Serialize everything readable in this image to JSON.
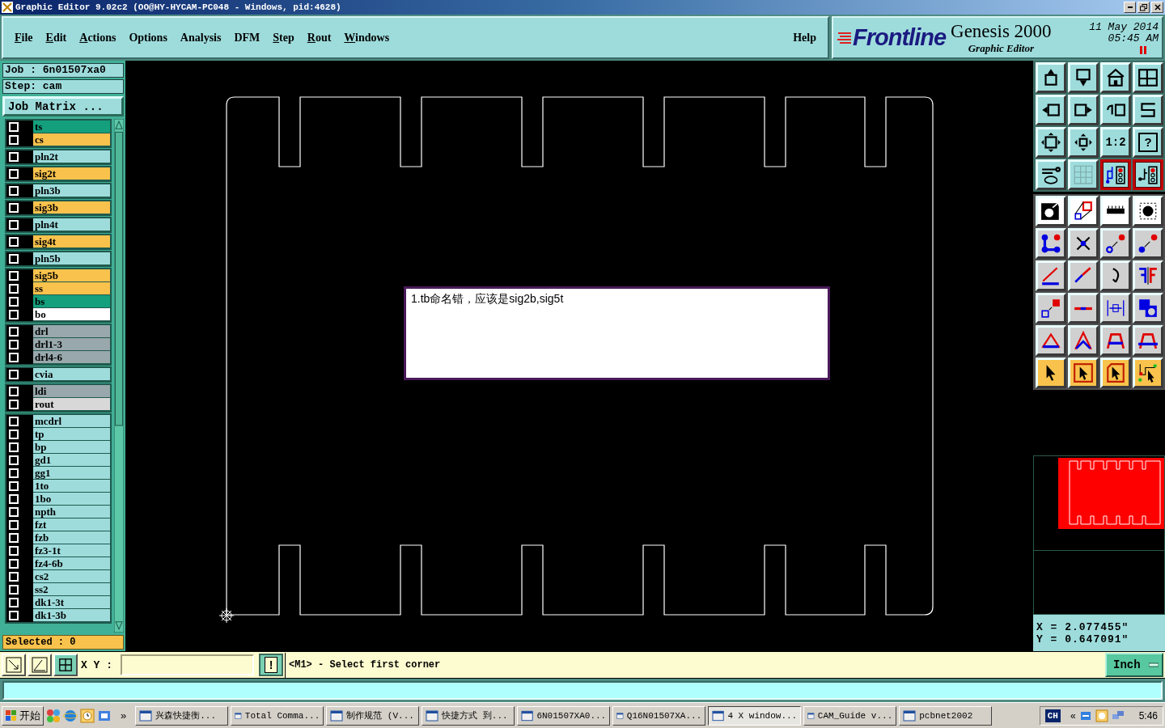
{
  "window": {
    "title": "Graphic Editor 9.02c2 (OO@HY-HYCAM-PC048 - Windows, pid:4628)"
  },
  "menu": [
    {
      "label": "File",
      "mnemonic": true
    },
    {
      "label": "Edit",
      "mnemonic": true
    },
    {
      "label": "Actions",
      "mnemonic": true
    },
    {
      "label": "Options",
      "mnemonic": false
    },
    {
      "label": "Analysis",
      "mnemonic": false
    },
    {
      "label": "DFM",
      "mnemonic": false
    },
    {
      "label": "Step",
      "mnemonic": true
    },
    {
      "label": "Rout",
      "mnemonic": true
    },
    {
      "label": "Windows",
      "mnemonic": true
    }
  ],
  "help": {
    "label": "Help",
    "mnemonic": false
  },
  "brand": {
    "logo": "Frontline",
    "product": "Genesis 2000",
    "subtitle": "Graphic Editor",
    "date": "11 May 2014",
    "time": "05:45 AM"
  },
  "job": {
    "job": "Job : 6n01507xa0",
    "step": "Step: cam",
    "matrix_button": "Job Matrix ..."
  },
  "layer_groups": [
    {
      "layers": [
        {
          "name": "ts",
          "color": "#14a07c",
          "checked": false
        },
        {
          "name": "cs",
          "color": "#f8c24c",
          "checked": false
        }
      ]
    },
    {
      "layers": [
        {
          "name": "pln2t",
          "color": "#9edcdc",
          "checked": false
        }
      ]
    },
    {
      "layers": [
        {
          "name": "sig2t",
          "color": "#f8c24c",
          "checked": false
        }
      ]
    },
    {
      "layers": [
        {
          "name": "pln3b",
          "color": "#9edcdc",
          "checked": false
        }
      ]
    },
    {
      "layers": [
        {
          "name": "sig3b",
          "color": "#f8c24c",
          "checked": false
        }
      ]
    },
    {
      "layers": [
        {
          "name": "pln4t",
          "color": "#9edcdc",
          "checked": false
        }
      ]
    },
    {
      "layers": [
        {
          "name": "sig4t",
          "color": "#f8c24c",
          "checked": false
        }
      ]
    },
    {
      "layers": [
        {
          "name": "pln5b",
          "color": "#9edcdc",
          "checked": false
        }
      ]
    },
    {
      "layers": [
        {
          "name": "sig5b",
          "color": "#f8c24c",
          "checked": false
        },
        {
          "name": "ss",
          "color": "#f8c24c",
          "checked": false
        },
        {
          "name": "bs",
          "color": "#14a07c",
          "checked": false
        },
        {
          "name": "bo",
          "color": "#ffffff",
          "checked": false
        }
      ]
    },
    {
      "layers": [
        {
          "name": "drl",
          "color": "#98a8ac",
          "checked": false
        },
        {
          "name": "drl1-3",
          "color": "#98a8ac",
          "checked": false
        },
        {
          "name": "drl4-6",
          "color": "#98a8ac",
          "checked": false
        }
      ]
    },
    {
      "layers": [
        {
          "name": "cvia",
          "color": "#9edcdc",
          "checked": false
        }
      ]
    },
    {
      "layers": [
        {
          "name": "ldi",
          "color": "#98a8ac",
          "checked": false
        },
        {
          "name": "rout",
          "color": "#d8d8d8",
          "checked": false
        }
      ]
    },
    {
      "layers": [
        {
          "name": "mcdrl",
          "color": "#9edcdc",
          "checked": false
        },
        {
          "name": "tp",
          "color": "#9edcdc",
          "checked": false
        },
        {
          "name": "bp",
          "color": "#9edcdc",
          "checked": false
        },
        {
          "name": "gd1",
          "color": "#9edcdc",
          "checked": false
        },
        {
          "name": "gg1",
          "color": "#9edcdc",
          "checked": false
        },
        {
          "name": "1to",
          "color": "#9edcdc",
          "checked": false
        },
        {
          "name": "1bo",
          "color": "#9edcdc",
          "checked": false
        },
        {
          "name": "npth",
          "color": "#9edcdc",
          "checked": false
        },
        {
          "name": "fzt",
          "color": "#9edcdc",
          "checked": false
        },
        {
          "name": "fzb",
          "color": "#9edcdc",
          "checked": false
        },
        {
          "name": "fz3-1t",
          "color": "#9edcdc",
          "checked": false
        },
        {
          "name": "fz4-6b",
          "color": "#9edcdc",
          "checked": false
        },
        {
          "name": "cs2",
          "color": "#9edcdc",
          "checked": false
        },
        {
          "name": "ss2",
          "color": "#9edcdc",
          "checked": false
        },
        {
          "name": "dk1-3t",
          "color": "#9edcdc",
          "checked": false
        },
        {
          "name": "dk1-3b",
          "color": "#9edcdc",
          "checked": false
        }
      ]
    }
  ],
  "selected_count": "Selected : 0",
  "canvas": {
    "note": "1.tb命名错，应该是sig2b,sig5t"
  },
  "view_tools": [
    {
      "kind": "icon",
      "selected": false
    },
    {
      "kind": "icon",
      "selected": false
    },
    {
      "kind": "icon",
      "selected": false
    },
    {
      "kind": "icon",
      "selected": false
    },
    {
      "kind": "icon",
      "selected": false
    },
    {
      "kind": "icon",
      "selected": false
    },
    {
      "kind": "icon",
      "selected": false
    },
    {
      "kind": "icon",
      "selected": false
    },
    {
      "kind": "icon",
      "selected": false
    },
    {
      "kind": "icon",
      "selected": false
    },
    {
      "kind": "label",
      "label": "1:2",
      "selected": false
    },
    {
      "kind": "framed",
      "label": "?",
      "selected": false
    },
    {
      "kind": "icon",
      "selected": false
    },
    {
      "kind": "icon",
      "selected": false
    },
    {
      "kind": "icon",
      "selected": true
    },
    {
      "kind": "icon",
      "selected": true
    }
  ],
  "edit_tools": [
    {
      "kind": "display"
    },
    {
      "kind": "display"
    },
    {
      "kind": "display"
    },
    {
      "kind": "display"
    },
    {
      "kind": "edit"
    },
    {
      "kind": "edit"
    },
    {
      "kind": "edit"
    },
    {
      "kind": "edit"
    },
    {
      "kind": "edit"
    },
    {
      "kind": "edit"
    },
    {
      "kind": "edit"
    },
    {
      "kind": "edit"
    },
    {
      "kind": "edit"
    },
    {
      "kind": "edit"
    },
    {
      "kind": "edit"
    },
    {
      "kind": "edit"
    },
    {
      "kind": "edit"
    },
    {
      "kind": "edit"
    },
    {
      "kind": "edit"
    },
    {
      "kind": "edit"
    },
    {
      "kind": "select"
    },
    {
      "kind": "select"
    },
    {
      "kind": "select"
    },
    {
      "kind": "select"
    }
  ],
  "coordinates": {
    "x": "X = 2.077455\"",
    "y": "Y = 0.647091\""
  },
  "command": {
    "xy_label": "X Y :",
    "alert": "!",
    "message": "<M1> - Select first corner",
    "units": "Inch"
  },
  "taskbar": {
    "start": "开始",
    "more": "»",
    "tasks": [
      {
        "label": "兴森快捷衡...",
        "selected": false
      },
      {
        "label": "Total Comma...",
        "selected": false
      },
      {
        "label": "制作规范 (V...",
        "selected": false
      },
      {
        "label": "快捷方式 到...",
        "selected": false
      },
      {
        "label": "6N01507XA0...",
        "selected": false
      },
      {
        "label": "Q16N01507XA...",
        "selected": false
      },
      {
        "label": "4 X window...",
        "selected": true
      },
      {
        "label": "CAM_Guide v...",
        "selected": false
      },
      {
        "label": "pcbnet2002",
        "selected": false
      }
    ],
    "language": "CH",
    "tray_toggle": "«",
    "clock": "5:46"
  }
}
